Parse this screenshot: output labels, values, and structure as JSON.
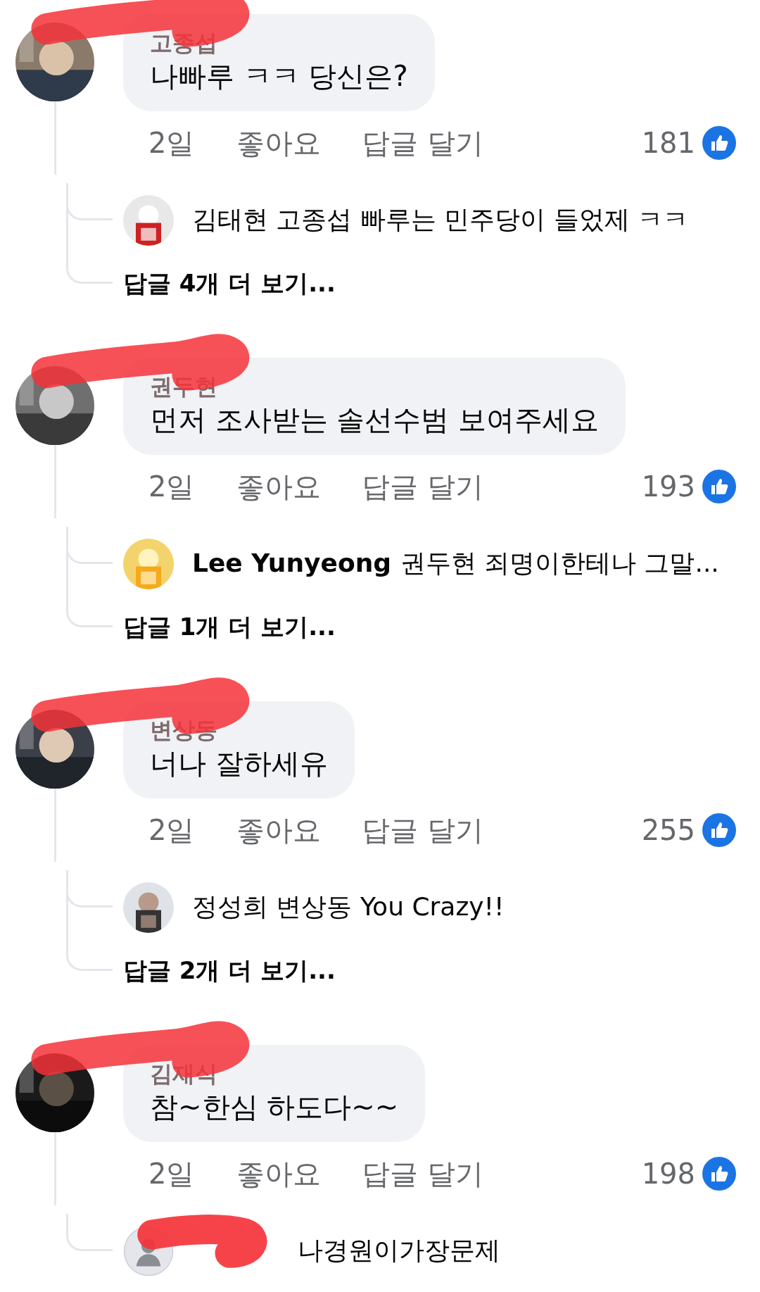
{
  "comments": [
    {
      "author": "고종섭",
      "scribbled": true,
      "text": "나빠루 ㅋㅋ 당신은?",
      "time": "2일",
      "like": "좋아요",
      "reply": "답글 달기",
      "reactions": "181",
      "replies": [
        {
          "name": "김태현",
          "name_bold": false,
          "text": "고종섭 빠루는 민주당이 들었제 ㅋㅋ"
        }
      ],
      "more": "답글 4개 더 보기..."
    },
    {
      "author": "권두현",
      "scribbled": true,
      "text": "먼저 조사받는 솔선수범 보여주세요",
      "time": "2일",
      "like": "좋아요",
      "reply": "답글 달기",
      "reactions": "193",
      "replies": [
        {
          "name": "Lee Yunyeong",
          "name_bold": true,
          "text": "권두현 죄명이한테나 그말..."
        }
      ],
      "more": "답글 1개 더 보기..."
    },
    {
      "author": "변상동",
      "scribbled": true,
      "text": "너나 잘하세유",
      "time": "2일",
      "like": "좋아요",
      "reply": "답글 달기",
      "reactions": "255",
      "replies": [
        {
          "name": "정성희",
          "name_bold": false,
          "text": "변상동 You Crazy!!"
        }
      ],
      "more": "답글 2개 더 보기..."
    },
    {
      "author": "김재식",
      "scribbled": true,
      "text": "참~한심 하도다~~",
      "time": "2일",
      "like": "좋아요",
      "reply": "답글 달기",
      "reactions": "198",
      "replies": [
        {
          "avatar": {
            "kind": "silhouette"
          },
          "text": "나경원이가장문제",
          "scribbled": true
        }
      ]
    }
  ]
}
